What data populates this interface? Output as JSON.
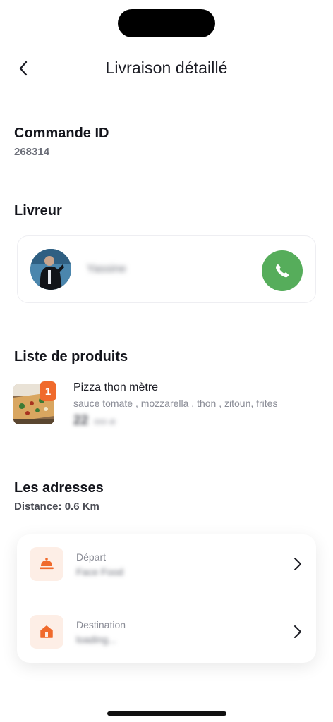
{
  "header": {
    "title": "Livraison détaillé",
    "back_icon": "chevron-left-icon"
  },
  "order": {
    "heading": "Commande ID",
    "id": "268314"
  },
  "driver": {
    "heading": "Livreur",
    "name": "Yassine",
    "call_icon": "phone-icon",
    "call_color": "#56ad5b"
  },
  "products": {
    "heading": "Liste de produits",
    "items": [
      {
        "quantity": "1",
        "name": "Pizza thon mètre",
        "description": "sauce tomate , mozzarella , thon , zitoun, frites",
        "price": "22",
        "currency": "000 dt"
      }
    ]
  },
  "addresses": {
    "heading": "Les adresses",
    "distance": "Distance: 0.6 Km",
    "departure": {
      "label": "Départ",
      "value": "Face Food",
      "icon": "cloche-icon"
    },
    "destination": {
      "label": "Destination",
      "value": "loading...",
      "icon": "home-icon"
    }
  },
  "colors": {
    "accent": "#f06a2c",
    "icon_bg": "#fdeee6"
  }
}
